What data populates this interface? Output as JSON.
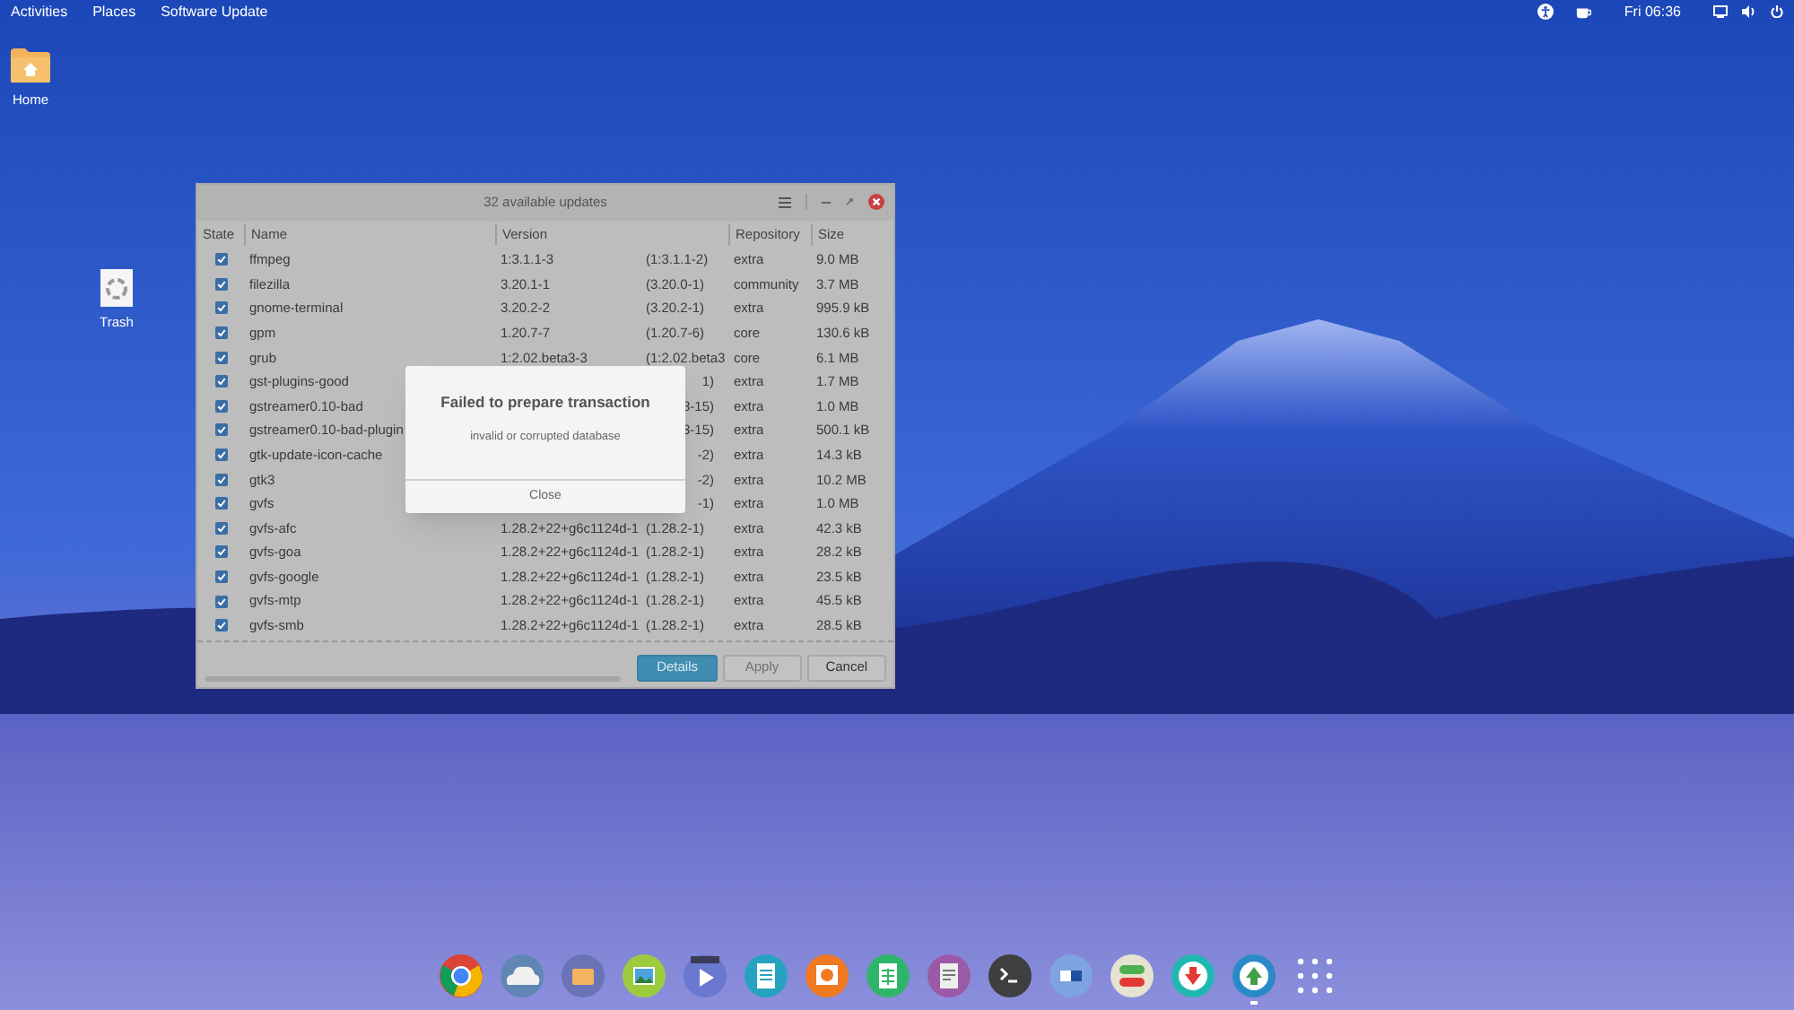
{
  "top_bar": {
    "menus": [
      "Activities",
      "Places",
      "Software Update"
    ],
    "clock": "Fri 06:36"
  },
  "desktop_icons": [
    {
      "kind": "home",
      "label": "Home"
    },
    {
      "kind": "trash",
      "label": "Trash"
    }
  ],
  "window": {
    "title": "32 available updates",
    "columns": [
      "State",
      "Name",
      "Version",
      "Repository",
      "Size"
    ],
    "rows": [
      {
        "checked": true,
        "name": "ffmpeg",
        "version": "1:3.1.1-3",
        "old_version": "(1:3.1.1-2)",
        "repository": "extra",
        "size": "9.0 MB"
      },
      {
        "checked": true,
        "name": "filezilla",
        "version": "3.20.1-1",
        "old_version": "(3.20.0-1)",
        "repository": "community",
        "size": "3.7 MB"
      },
      {
        "checked": true,
        "name": "gnome-terminal",
        "version": "3.20.2-2",
        "old_version": "(3.20.2-1)",
        "repository": "extra",
        "size": "995.9 kB"
      },
      {
        "checked": true,
        "name": "gpm",
        "version": "1.20.7-7",
        "old_version": "(1.20.7-6)",
        "repository": "core",
        "size": "130.6 kB"
      },
      {
        "checked": true,
        "name": "grub",
        "version": "1:2.02.beta3-3",
        "old_version": "(1:2.02.beta3",
        "repository": "core",
        "size": "6.1 MB"
      },
      {
        "checked": true,
        "name": "gst-plugins-good",
        "old_version": "1)",
        "repository": "extra",
        "size": "1.7 MB"
      },
      {
        "checked": true,
        "name": "gstreamer0.10-bad",
        "old_version": "3-15)",
        "repository": "extra",
        "size": "1.0 MB"
      },
      {
        "checked": true,
        "name": "gstreamer0.10-bad-plugin",
        "old_version": "3-15)",
        "repository": "extra",
        "size": "500.1 kB"
      },
      {
        "checked": true,
        "name": "gtk-update-icon-cache",
        "old_version": "-2)",
        "repository": "extra",
        "size": "14.3 kB"
      },
      {
        "checked": true,
        "name": "gtk3",
        "old_version": "-2)",
        "repository": "extra",
        "size": "10.2 MB"
      },
      {
        "checked": true,
        "name": "gvfs",
        "old_version": "-1)",
        "repository": "extra",
        "size": "1.0 MB"
      },
      {
        "checked": true,
        "name": "gvfs-afc",
        "version": "1.28.2+22+g6c1124d-1",
        "old_version": "(1.28.2-1)",
        "repository": "extra",
        "size": "42.3 kB"
      },
      {
        "checked": true,
        "name": "gvfs-goa",
        "version": "1.28.2+22+g6c1124d-1",
        "old_version": "(1.28.2-1)",
        "repository": "extra",
        "size": "28.2 kB"
      },
      {
        "checked": true,
        "name": "gvfs-google",
        "version": "1.28.2+22+g6c1124d-1",
        "old_version": "(1.28.2-1)",
        "repository": "extra",
        "size": "23.5 kB"
      },
      {
        "checked": true,
        "name": "gvfs-mtp",
        "version": "1.28.2+22+g6c1124d-1",
        "old_version": "(1.28.2-1)",
        "repository": "extra",
        "size": "45.5 kB"
      },
      {
        "checked": true,
        "name": "gvfs-smb",
        "version": "1.28.2+22+g6c1124d-1",
        "old_version": "(1.28.2-1)",
        "repository": "extra",
        "size": "28.5 kB"
      }
    ],
    "buttons": [
      {
        "label": "Details",
        "kind": "primary",
        "disabled": false
      },
      {
        "label": "Apply",
        "kind": "normal",
        "disabled": true
      },
      {
        "label": "Cancel",
        "kind": "normal",
        "disabled": false
      }
    ]
  },
  "dialog": {
    "title": "Failed to prepare transaction",
    "message": "invalid or corrupted database",
    "button": "Close"
  },
  "dock": [
    {
      "kind": "browser",
      "active": false
    },
    {
      "kind": "cloud",
      "active": false
    },
    {
      "kind": "files",
      "active": false
    },
    {
      "kind": "images",
      "active": false
    },
    {
      "kind": "video",
      "active": false
    },
    {
      "kind": "document",
      "active": false
    },
    {
      "kind": "presentation",
      "active": false
    },
    {
      "kind": "spreadsheet",
      "active": false
    },
    {
      "kind": "text",
      "active": false
    },
    {
      "kind": "terminal",
      "active": false
    },
    {
      "kind": "windows",
      "active": false
    },
    {
      "kind": "toggles",
      "active": false
    },
    {
      "kind": "download",
      "active": false
    },
    {
      "kind": "update",
      "active": true
    },
    {
      "kind": "grid",
      "active": false
    }
  ]
}
